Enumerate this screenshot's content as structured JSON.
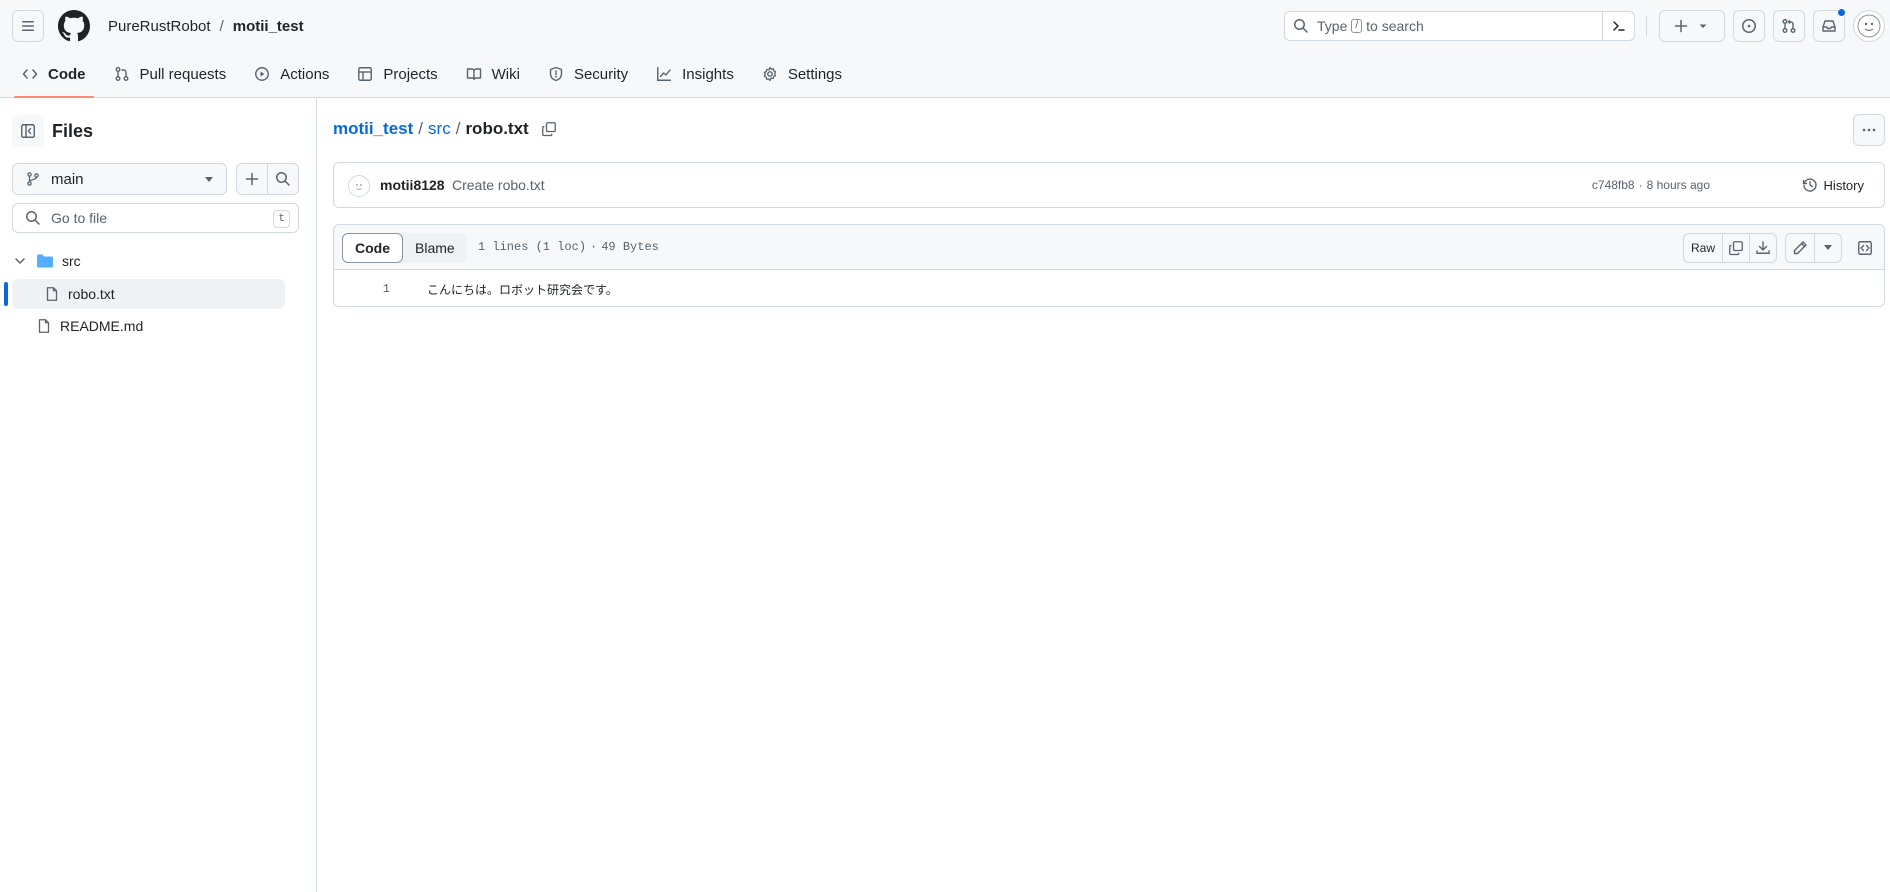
{
  "header": {
    "owner": "PureRustRobot",
    "separator": "/",
    "repo": "motii_test",
    "search": {
      "prefix": "Type",
      "key": "/",
      "suffix": "to search"
    }
  },
  "nav": {
    "tabs": [
      {
        "label": "Code",
        "icon": "code-icon",
        "selected": true
      },
      {
        "label": "Pull requests",
        "icon": "pull-request-icon"
      },
      {
        "label": "Actions",
        "icon": "play-icon"
      },
      {
        "label": "Projects",
        "icon": "table-icon"
      },
      {
        "label": "Wiki",
        "icon": "book-icon"
      },
      {
        "label": "Security",
        "icon": "shield-icon"
      },
      {
        "label": "Insights",
        "icon": "graph-icon"
      },
      {
        "label": "Settings",
        "icon": "gear-icon"
      }
    ]
  },
  "sidebar": {
    "title": "Files",
    "branch": "main",
    "goto_placeholder": "Go to file",
    "goto_shortcut": "t",
    "tree": [
      {
        "name": "src",
        "type": "folder",
        "expanded": true
      },
      {
        "name": "robo.txt",
        "type": "file",
        "active": true
      },
      {
        "name": "README.md",
        "type": "file"
      }
    ]
  },
  "main": {
    "path": {
      "repo": "motii_test",
      "dir": "src",
      "file": "robo.txt",
      "sep": "/"
    },
    "commit": {
      "author": "motii8128",
      "message": "Create robo.txt",
      "sha": "c748fb8",
      "dot": "·",
      "time": "8 hours ago",
      "history_label": "History"
    },
    "file": {
      "tabs": [
        "Code",
        "Blame"
      ],
      "lines": "1 lines (1 loc)",
      "dot": "·",
      "size": "49 Bytes",
      "raw_label": "Raw",
      "content": [
        {
          "num": "1",
          "text": "こんにちは。ロボット研究会です。"
        }
      ]
    }
  },
  "colors": {
    "accent": "#0969da",
    "tab_underline": "#fd8c73",
    "border": "#d1d9e0",
    "folder": "#54aeff"
  }
}
